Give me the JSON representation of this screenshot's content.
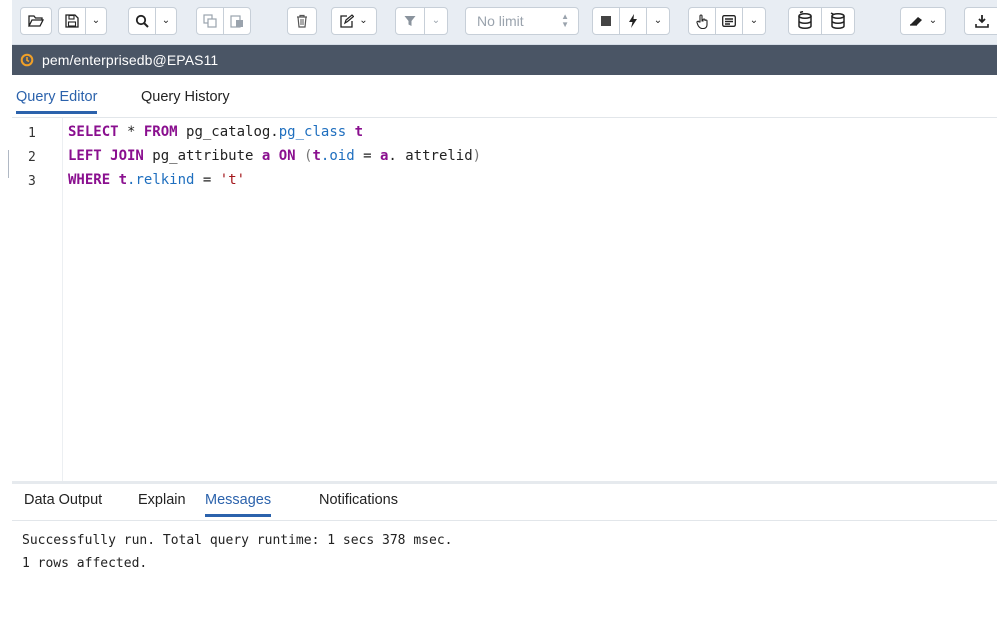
{
  "toolbar": {
    "limit_placeholder": "No limit",
    "buttons": [
      {
        "name": "open-file-icon",
        "glyph": "folder-open"
      },
      {
        "name": "save-icon",
        "glyph": "floppy"
      },
      {
        "name": "find-icon",
        "glyph": "search"
      },
      {
        "name": "copy-icon",
        "glyph": "copy"
      },
      {
        "name": "paste-icon",
        "glyph": "paste"
      },
      {
        "name": "delete-icon",
        "glyph": "trash"
      },
      {
        "name": "edit-icon",
        "glyph": "pencil-square"
      },
      {
        "name": "filter-icon",
        "glyph": "funnel"
      },
      {
        "name": "stop-icon",
        "glyph": "square"
      },
      {
        "name": "execute-icon",
        "glyph": "bolt"
      },
      {
        "name": "explain-icon",
        "glyph": "hand-pointer"
      },
      {
        "name": "explain-analyze-icon",
        "glyph": "list-box"
      },
      {
        "name": "commit-icon",
        "glyph": "db-check"
      },
      {
        "name": "rollback-icon",
        "glyph": "db-undo"
      },
      {
        "name": "clear-icon",
        "glyph": "eraser"
      },
      {
        "name": "download-icon",
        "glyph": "download"
      }
    ]
  },
  "connection": {
    "label": "pem/enterprisedb@EPAS11",
    "status_color": "#f0a028"
  },
  "query_tabs": [
    {
      "label": "Query Editor",
      "active": true
    },
    {
      "label": "Query History",
      "active": false
    }
  ],
  "editor": {
    "line_numbers": [
      "1",
      "2",
      "3"
    ],
    "lines": [
      [
        {
          "t": "SELECT",
          "c": "kw"
        },
        {
          "t": " * ",
          "c": ""
        },
        {
          "t": "FROM",
          "c": "kw"
        },
        {
          "t": " pg_catalog.",
          "c": ""
        },
        {
          "t": "pg_class",
          "c": "fn"
        },
        {
          "t": " ",
          "c": ""
        },
        {
          "t": "t",
          "c": "kw"
        }
      ],
      [
        {
          "t": "LEFT JOIN",
          "c": "kw"
        },
        {
          "t": " pg_attribute ",
          "c": ""
        },
        {
          "t": "a",
          "c": "kw"
        },
        {
          "t": " ",
          "c": ""
        },
        {
          "t": "ON",
          "c": "kw"
        },
        {
          "t": " ",
          "c": ""
        },
        {
          "t": "(",
          "c": "paren"
        },
        {
          "t": "t",
          "c": "kw"
        },
        {
          "t": ".oid",
          "c": "fn"
        },
        {
          "t": " = ",
          "c": ""
        },
        {
          "t": "a",
          "c": "kw"
        },
        {
          "t": ". attrelid",
          "c": ""
        },
        {
          "t": ")",
          "c": "paren"
        }
      ],
      [
        {
          "t": "WHERE",
          "c": "kw"
        },
        {
          "t": " ",
          "c": ""
        },
        {
          "t": "t",
          "c": "kw"
        },
        {
          "t": ".relkind",
          "c": "fn"
        },
        {
          "t": " = ",
          "c": ""
        },
        {
          "t": "'t'",
          "c": "str"
        }
      ]
    ]
  },
  "result_tabs": [
    {
      "label": "Data Output",
      "active": false
    },
    {
      "label": "Explain",
      "active": false
    },
    {
      "label": "Messages",
      "active": true
    },
    {
      "label": "Notifications",
      "active": false
    }
  ],
  "messages": {
    "line1": "Successfully run. Total query runtime: 1 secs 378 msec.",
    "line2": "1 rows affected."
  }
}
